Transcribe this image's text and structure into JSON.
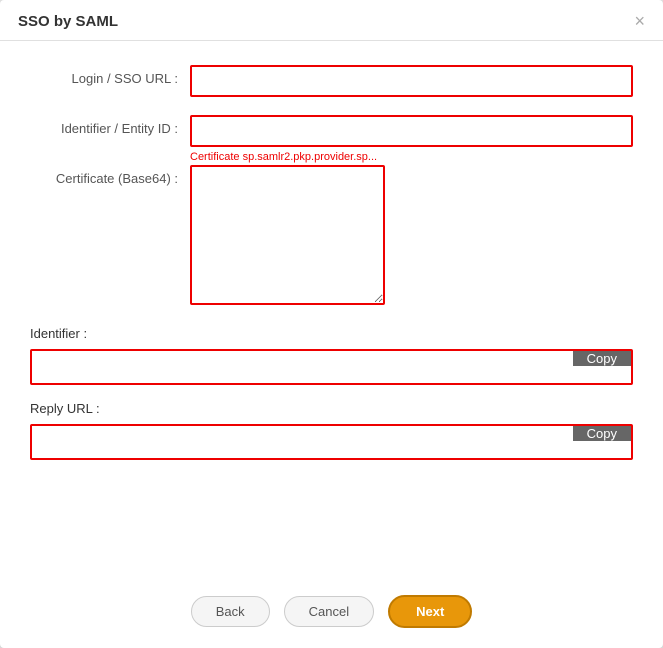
{
  "dialog": {
    "title": "SSO by SAML",
    "close_label": "×"
  },
  "form": {
    "login_sso_url_label": "Login / SSO URL :",
    "login_sso_url_value": "",
    "identifier_entity_id_label": "Identifier / Entity ID :",
    "identifier_entity_id_value": "",
    "certificate_label": "Certificate (Base64) :",
    "certificate_value": "",
    "certificate_hint": "Certificate sp.samlr2.pkp.provider.sp..."
  },
  "identifier_section": {
    "label": "Identifier :",
    "value": "",
    "copy_label": "Copy"
  },
  "reply_url_section": {
    "label": "Reply URL :",
    "value": "",
    "copy_label": "Copy"
  },
  "footer": {
    "back_label": "Back",
    "cancel_label": "Cancel",
    "next_label": "Next"
  }
}
